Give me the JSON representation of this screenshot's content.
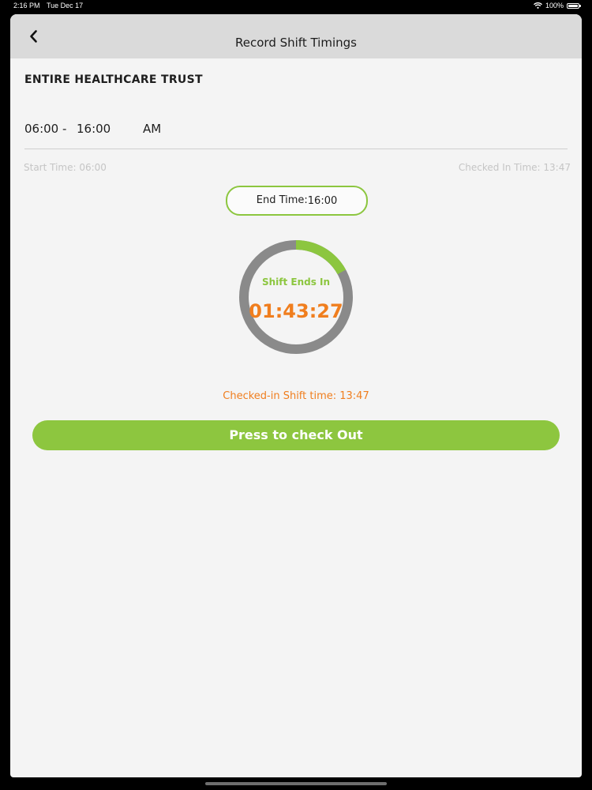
{
  "status_bar": {
    "time": "2:16 PM",
    "date": "Tue Dec 17",
    "battery": "100%",
    "icons": [
      "wifi-icon",
      "battery-icon"
    ]
  },
  "navbar": {
    "title": "Record Shift Timings",
    "back_icon": "chevron-left-icon"
  },
  "shift": {
    "organization": "ENTIRE HEALTHCARE TRUST",
    "start": "06:00",
    "separator": "-",
    "end": "16:00",
    "period": "AM",
    "start_time_label": "Start Time: 06:00",
    "checked_in_label": "Checked In Time: 13:47",
    "end_time_label": "End Time:",
    "end_time_value": "16:00"
  },
  "timer": {
    "label": "Shift Ends In",
    "value": "01:43:27",
    "progress_fraction": 0.17,
    "colors": {
      "progress": "#8cc63f",
      "track": "#8a8a8a"
    }
  },
  "checked_in_shift": "Checked-in Shift time: 13:47",
  "checkout_button": {
    "label": "Press to check Out",
    "color": "#8dc63f"
  },
  "colors": {
    "accent_green": "#8cc63f",
    "accent_orange": "#f07e1e",
    "navbar_bg": "#dadada",
    "background": "#f4f4f4"
  }
}
